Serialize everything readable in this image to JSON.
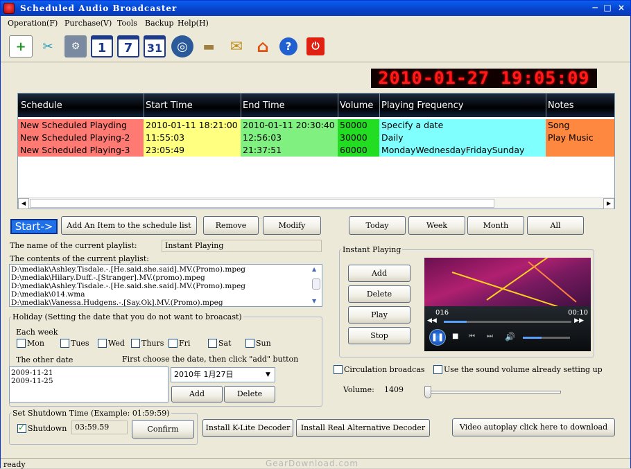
{
  "window": {
    "title": "Scheduled Audio Broadcaster"
  },
  "menu": [
    "Operation(F)",
    "Purchase(V)",
    "Tools",
    "Backup",
    "Help(H)"
  ],
  "toolbar": {
    "icons": [
      "add-schedule-icon",
      "scissors-icon",
      "settings-tools-icon",
      "day-1-icon",
      "day-7-icon",
      "day-31-icon",
      "film-reel-icon",
      "scanner-icon",
      "mail-icon",
      "home-icon",
      "help-icon",
      "power-icon"
    ],
    "cal_1": "1",
    "cal_7": "7",
    "cal_31": "31"
  },
  "clock": "2010-01-27 19:05:09",
  "schedule": {
    "columns": [
      "Schedule",
      "Start Time",
      "End Time",
      "Volume",
      "Playing Frequency",
      "Notes"
    ],
    "rows": [
      [
        "New Scheduled Playding",
        "2010-01-11 18:21:00",
        "2010-01-11 20:30:40",
        "50000",
        "Specify a date",
        "Song"
      ],
      [
        "New Scheduled Playing-2",
        "11:55:03",
        "12:56:03",
        "30000",
        "Daily",
        "Play Music"
      ],
      [
        "New Scheduled Playing-3",
        "23:05:49",
        "21:37:51",
        "60000",
        "MondayWednesdayFridaySunday",
        ""
      ]
    ]
  },
  "actions": {
    "start": "Start->",
    "add_item": "Add An Item to the schedule list",
    "remove": "Remove",
    "modify": "Modify",
    "today": "Today",
    "week": "Week",
    "month": "Month",
    "all": "All"
  },
  "playlist": {
    "name_label": "The name of the current playlist:",
    "name_value": "Instant Playing",
    "contents_label": "The contents of the current playlist:",
    "items": [
      "D:\\mediak\\Ashley.Tisdale.-.[He.said.she.said].MV.(Promo).mpeg",
      "D:\\mediak\\Hilary.Duff.-.[Stranger].MV.(promo).mpeg",
      "D:\\mediak\\Ashley.Tisdale.-.[He.said.she.said].MV.(Promo).mpeg",
      "D:\\mediak\\014.wma",
      "D:\\mediak\\Vanessa.Hudgens.-.[Say.Ok].MV.(Promo).mpeg"
    ]
  },
  "holiday": {
    "legend": "Holiday  (Setting the date that you do not want to broacast)",
    "each_week": "Each week",
    "days": [
      "Mon",
      "Tues",
      "Wed",
      "Thurs",
      "Fri",
      "Sat",
      "Sun"
    ],
    "other_date": "The other date",
    "instruction": "First choose the date, then click \"add\" button",
    "dates": [
      "2009-11-21",
      "2009-11-25"
    ],
    "date_select": "2010年 1月27日",
    "add": "Add",
    "delete": "Delete"
  },
  "instant": {
    "legend": "Instant Playing",
    "add": "Add",
    "delete": "Delete",
    "play": "Play",
    "stop": "Stop",
    "time_left": "016",
    "time_right": "00:10",
    "progress": 0.18,
    "volume_level": 0.4
  },
  "options": {
    "circulation": "Circulation broadcas",
    "use_volume": "Use the sound volume already setting up",
    "volume_label": "Volume:",
    "volume_value": "1409"
  },
  "shutdown": {
    "legend": "Set Shutdown Time (Example: 01:59:59)",
    "label": "Shutdown",
    "checked": true,
    "time": "03:59.59",
    "confirm": "Confirm"
  },
  "decoders": {
    "klite": "Install K-Lite Decoder",
    "real": "Install Real Alternative Decoder",
    "video_autoplay": "Video autoplay click here to download"
  },
  "status": {
    "text": "ready",
    "watermark": "GearDownload.com"
  }
}
